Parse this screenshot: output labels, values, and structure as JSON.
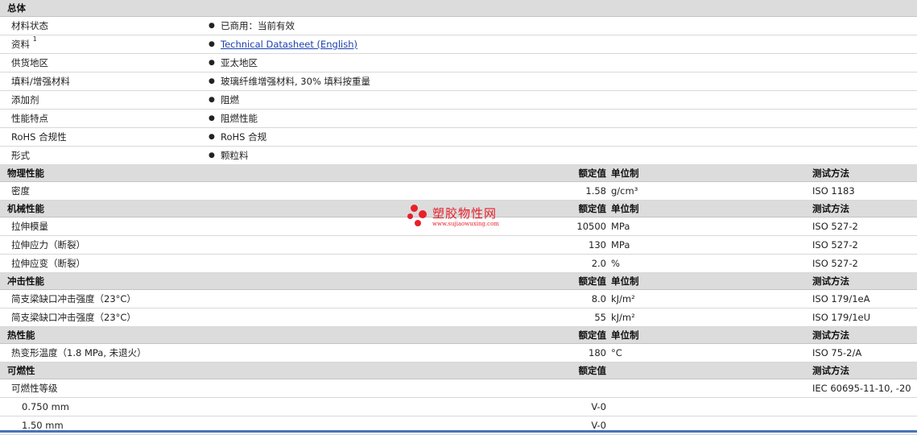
{
  "general": {
    "title": "总体",
    "rows": [
      {
        "label": "材料状态",
        "value": "已商用：当前有效"
      },
      {
        "label": "资料",
        "sup": "1",
        "value": "Technical Datasheet (English)",
        "link": true
      },
      {
        "label": "供货地区",
        "value": "亚太地区"
      },
      {
        "label": "填料/增强材料",
        "value": "玻璃纤维增强材料, 30% 填料按重量"
      },
      {
        "label": "添加剂",
        "value": "阻燃"
      },
      {
        "label": "性能特点",
        "value": "阻燃性能"
      },
      {
        "label": "RoHS 合规性",
        "value": "RoHS 合规"
      },
      {
        "label": "形式",
        "value": "颗粒料"
      }
    ]
  },
  "sections": [
    {
      "title": "物理性能",
      "h_value": "额定值",
      "h_unit": "单位制",
      "h_test": "测试方法",
      "rows": [
        {
          "label": "密度",
          "value": "1.58",
          "unit": "g/cm³",
          "test": "ISO 1183"
        }
      ]
    },
    {
      "title": "机械性能",
      "h_value": "额定值",
      "h_unit": "单位制",
      "h_test": "测试方法",
      "rows": [
        {
          "label": "拉伸模量",
          "value": "10500",
          "unit": "MPa",
          "test": "ISO 527-2"
        },
        {
          "label": "拉伸应力（断裂）",
          "value": "130",
          "unit": "MPa",
          "test": "ISO 527-2"
        },
        {
          "label": "拉伸应变（断裂）",
          "value": "2.0",
          "unit": "%",
          "test": "ISO 527-2"
        }
      ]
    },
    {
      "title": "冲击性能",
      "h_value": "额定值",
      "h_unit": "单位制",
      "h_test": "测试方法",
      "rows": [
        {
          "label": "简支梁缺口冲击强度（23°C）",
          "value": "8.0",
          "unit": "kJ/m²",
          "test": "ISO 179/1eA"
        },
        {
          "label": "简支梁缺口冲击强度（23°C）",
          "value": "55",
          "unit": "kJ/m²",
          "test": "ISO 179/1eU"
        }
      ]
    },
    {
      "title": "热性能",
      "h_value": "额定值",
      "h_unit": "单位制",
      "h_test": "测试方法",
      "rows": [
        {
          "label": "热变形温度（1.8 MPa, 未退火）",
          "value": "180",
          "unit": "°C",
          "test": "ISO 75-2/A"
        }
      ]
    },
    {
      "title": "可燃性",
      "h_value": "额定值",
      "h_unit": "",
      "h_test": "测试方法",
      "rows": [
        {
          "label": "可燃性等级",
          "value": "",
          "unit": "",
          "test": "IEC 60695-11-10, -20"
        },
        {
          "label": "0.750 mm",
          "value": "V-0",
          "unit": "",
          "test": "",
          "sub": true
        },
        {
          "label": "1.50 mm",
          "value": "V-0",
          "unit": "",
          "test": "",
          "sub": true
        }
      ]
    }
  ],
  "watermark": {
    "title": "塑胶物性网",
    "url": "www.sujiaowuxing.com",
    "color": "#e8202a"
  },
  "bullet": "●"
}
